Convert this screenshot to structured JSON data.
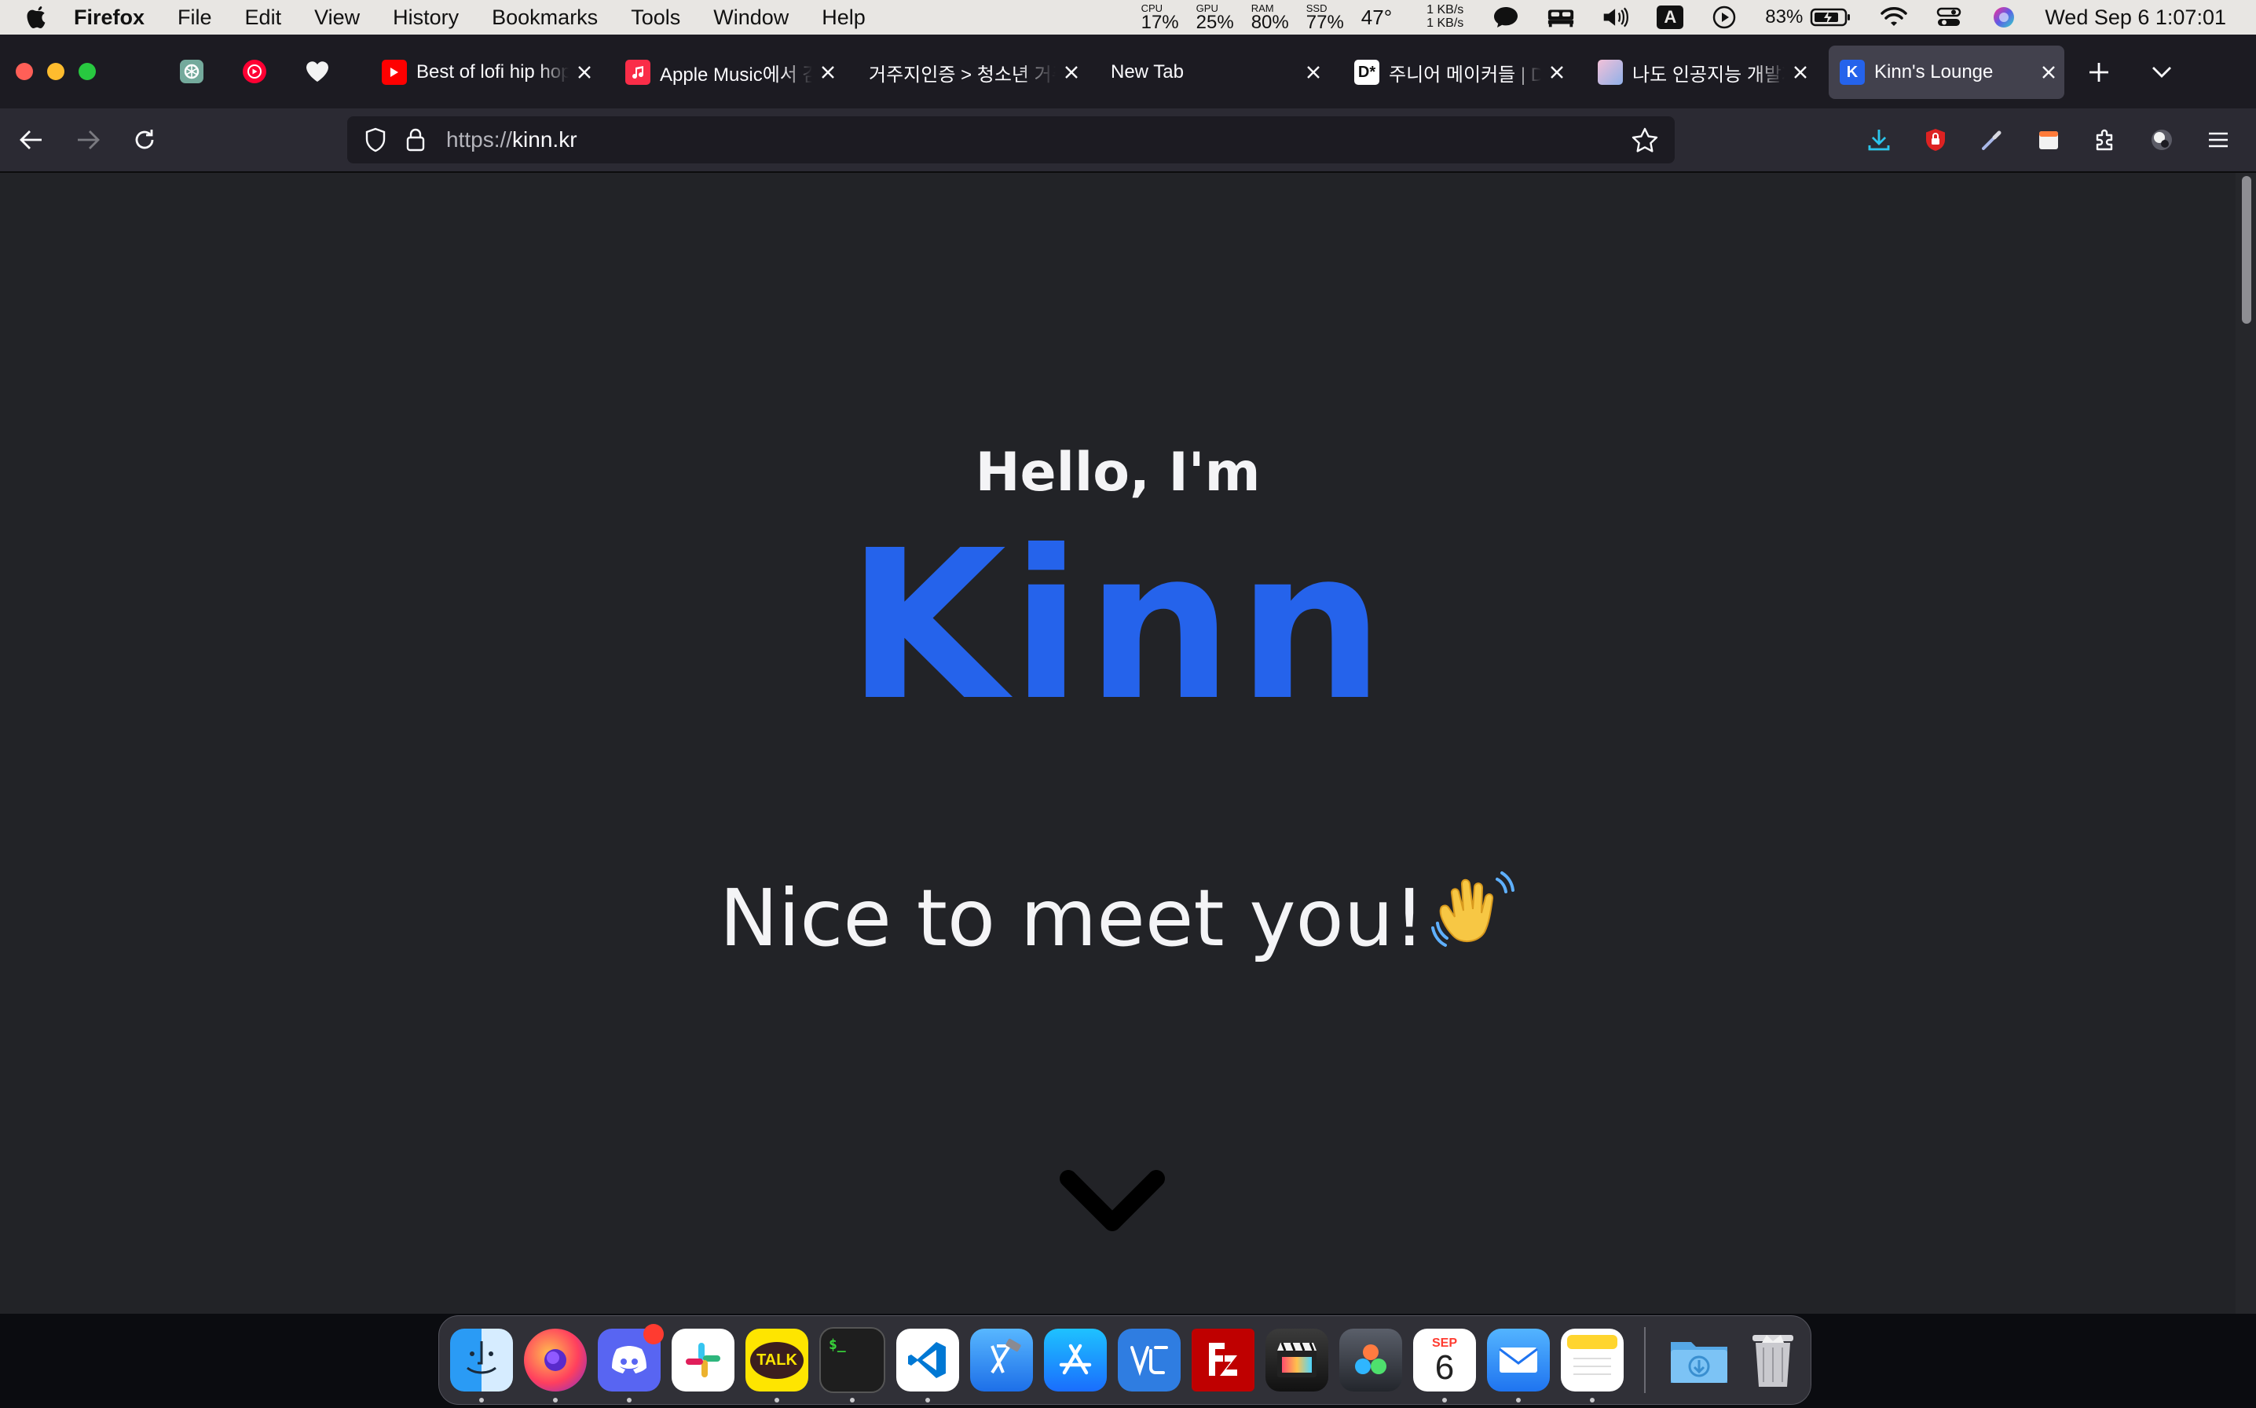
{
  "menubar": {
    "app_name": "Firefox",
    "menus": [
      "File",
      "Edit",
      "View",
      "History",
      "Bookmarks",
      "Tools",
      "Window",
      "Help"
    ],
    "stats": [
      {
        "label": "CPU",
        "value": "17%"
      },
      {
        "label": "GPU",
        "value": "25%"
      },
      {
        "label": "RAM",
        "value": "80%"
      },
      {
        "label": "SSD",
        "value": "77%"
      }
    ],
    "temperature": "47°",
    "net_up": "1 KB/s",
    "net_down": "1 KB/s",
    "input_source": "A",
    "battery": "83%",
    "clock": "Wed Sep 6  1:07:01"
  },
  "tabs": {
    "pinned_icons": [
      "chatgpt-icon",
      "youtube-music-icon",
      "heart-icon"
    ],
    "items": [
      {
        "title": "Best of lofi hip hop",
        "favicon": "youtube-icon",
        "color": "#ff0000",
        "active": false
      },
      {
        "title": "Apple Music에서 감상",
        "favicon": "apple-music-icon",
        "color": "#fa2d48",
        "active": false
      },
      {
        "title": "거주지인증 > 청소년 거주지",
        "favicon": "",
        "color": "",
        "active": false
      },
      {
        "title": "New Tab",
        "favicon": "",
        "color": "",
        "active": false
      },
      {
        "title": "주니어 메이커들 | Disquiet",
        "favicon": "disquiet-icon",
        "color": "#ffffff",
        "active": false
      },
      {
        "title": "나도 인공지능 개발자",
        "favicon": "image-favicon-icon",
        "color": "#d9a3c8",
        "active": false
      },
      {
        "title": "Kinn's Lounge",
        "favicon": "kinn-icon",
        "color": "#2563eb",
        "active": true
      }
    ]
  },
  "navbar": {
    "url_scheme": "https://",
    "url_host": "kinn.kr"
  },
  "page": {
    "greeting": "Hello, I'm",
    "name": "Kinn",
    "subline": "Nice to meet you!",
    "accent_color": "#2563eb",
    "background_color": "#222327"
  },
  "dock": {
    "apps": [
      "Finder",
      "Firefox",
      "Discord",
      "Slack",
      "KakaoTalk",
      "Terminal",
      "Visual Studio Code",
      "Xcode",
      "App Store",
      "Visual Paradigm",
      "FileZilla",
      "Final Cut Pro",
      "DaVinci Resolve",
      "Calendar",
      "Mail",
      "Notes"
    ],
    "calendar_month": "SEP",
    "calendar_day": "6",
    "kakao_label": "TALK",
    "folder": "Downloads",
    "trash": "Trash"
  }
}
